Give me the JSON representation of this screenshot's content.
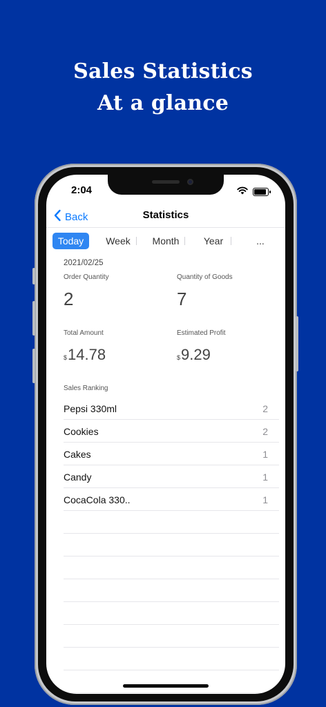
{
  "promo": {
    "line1": "Sales Statistics",
    "line2": "At a glance",
    "background_color": "#0033a1"
  },
  "status_bar": {
    "time": "2:04",
    "icons": [
      "wifi-icon",
      "battery-icon"
    ]
  },
  "nav": {
    "back_label": "Back",
    "title": "Statistics",
    "accent_color": "#0a7aff"
  },
  "segments": {
    "items": [
      "Today",
      "Week",
      "Month",
      "Year",
      "..."
    ],
    "selected": "Today",
    "selected_color": "#2f86f2"
  },
  "stats": {
    "date": "2021/02/25",
    "order_quantity_label": "Order Quantity",
    "order_quantity": "2",
    "goods_quantity_label": "Quantity of Goods",
    "goods_quantity": "7",
    "total_amount_label": "Total Amount",
    "total_amount_currency": "$",
    "total_amount": "14.78",
    "profit_label": "Estimated Profit",
    "profit_currency": "$",
    "profit": "9.29"
  },
  "ranking": {
    "title": "Sales Ranking",
    "rows": [
      {
        "name": "Pepsi 330ml",
        "count": "2"
      },
      {
        "name": "Cookies",
        "count": "2"
      },
      {
        "name": "Cakes",
        "count": "1"
      },
      {
        "name": "Candy",
        "count": "1"
      },
      {
        "name": "CocaCola 330..",
        "count": "1"
      }
    ]
  }
}
